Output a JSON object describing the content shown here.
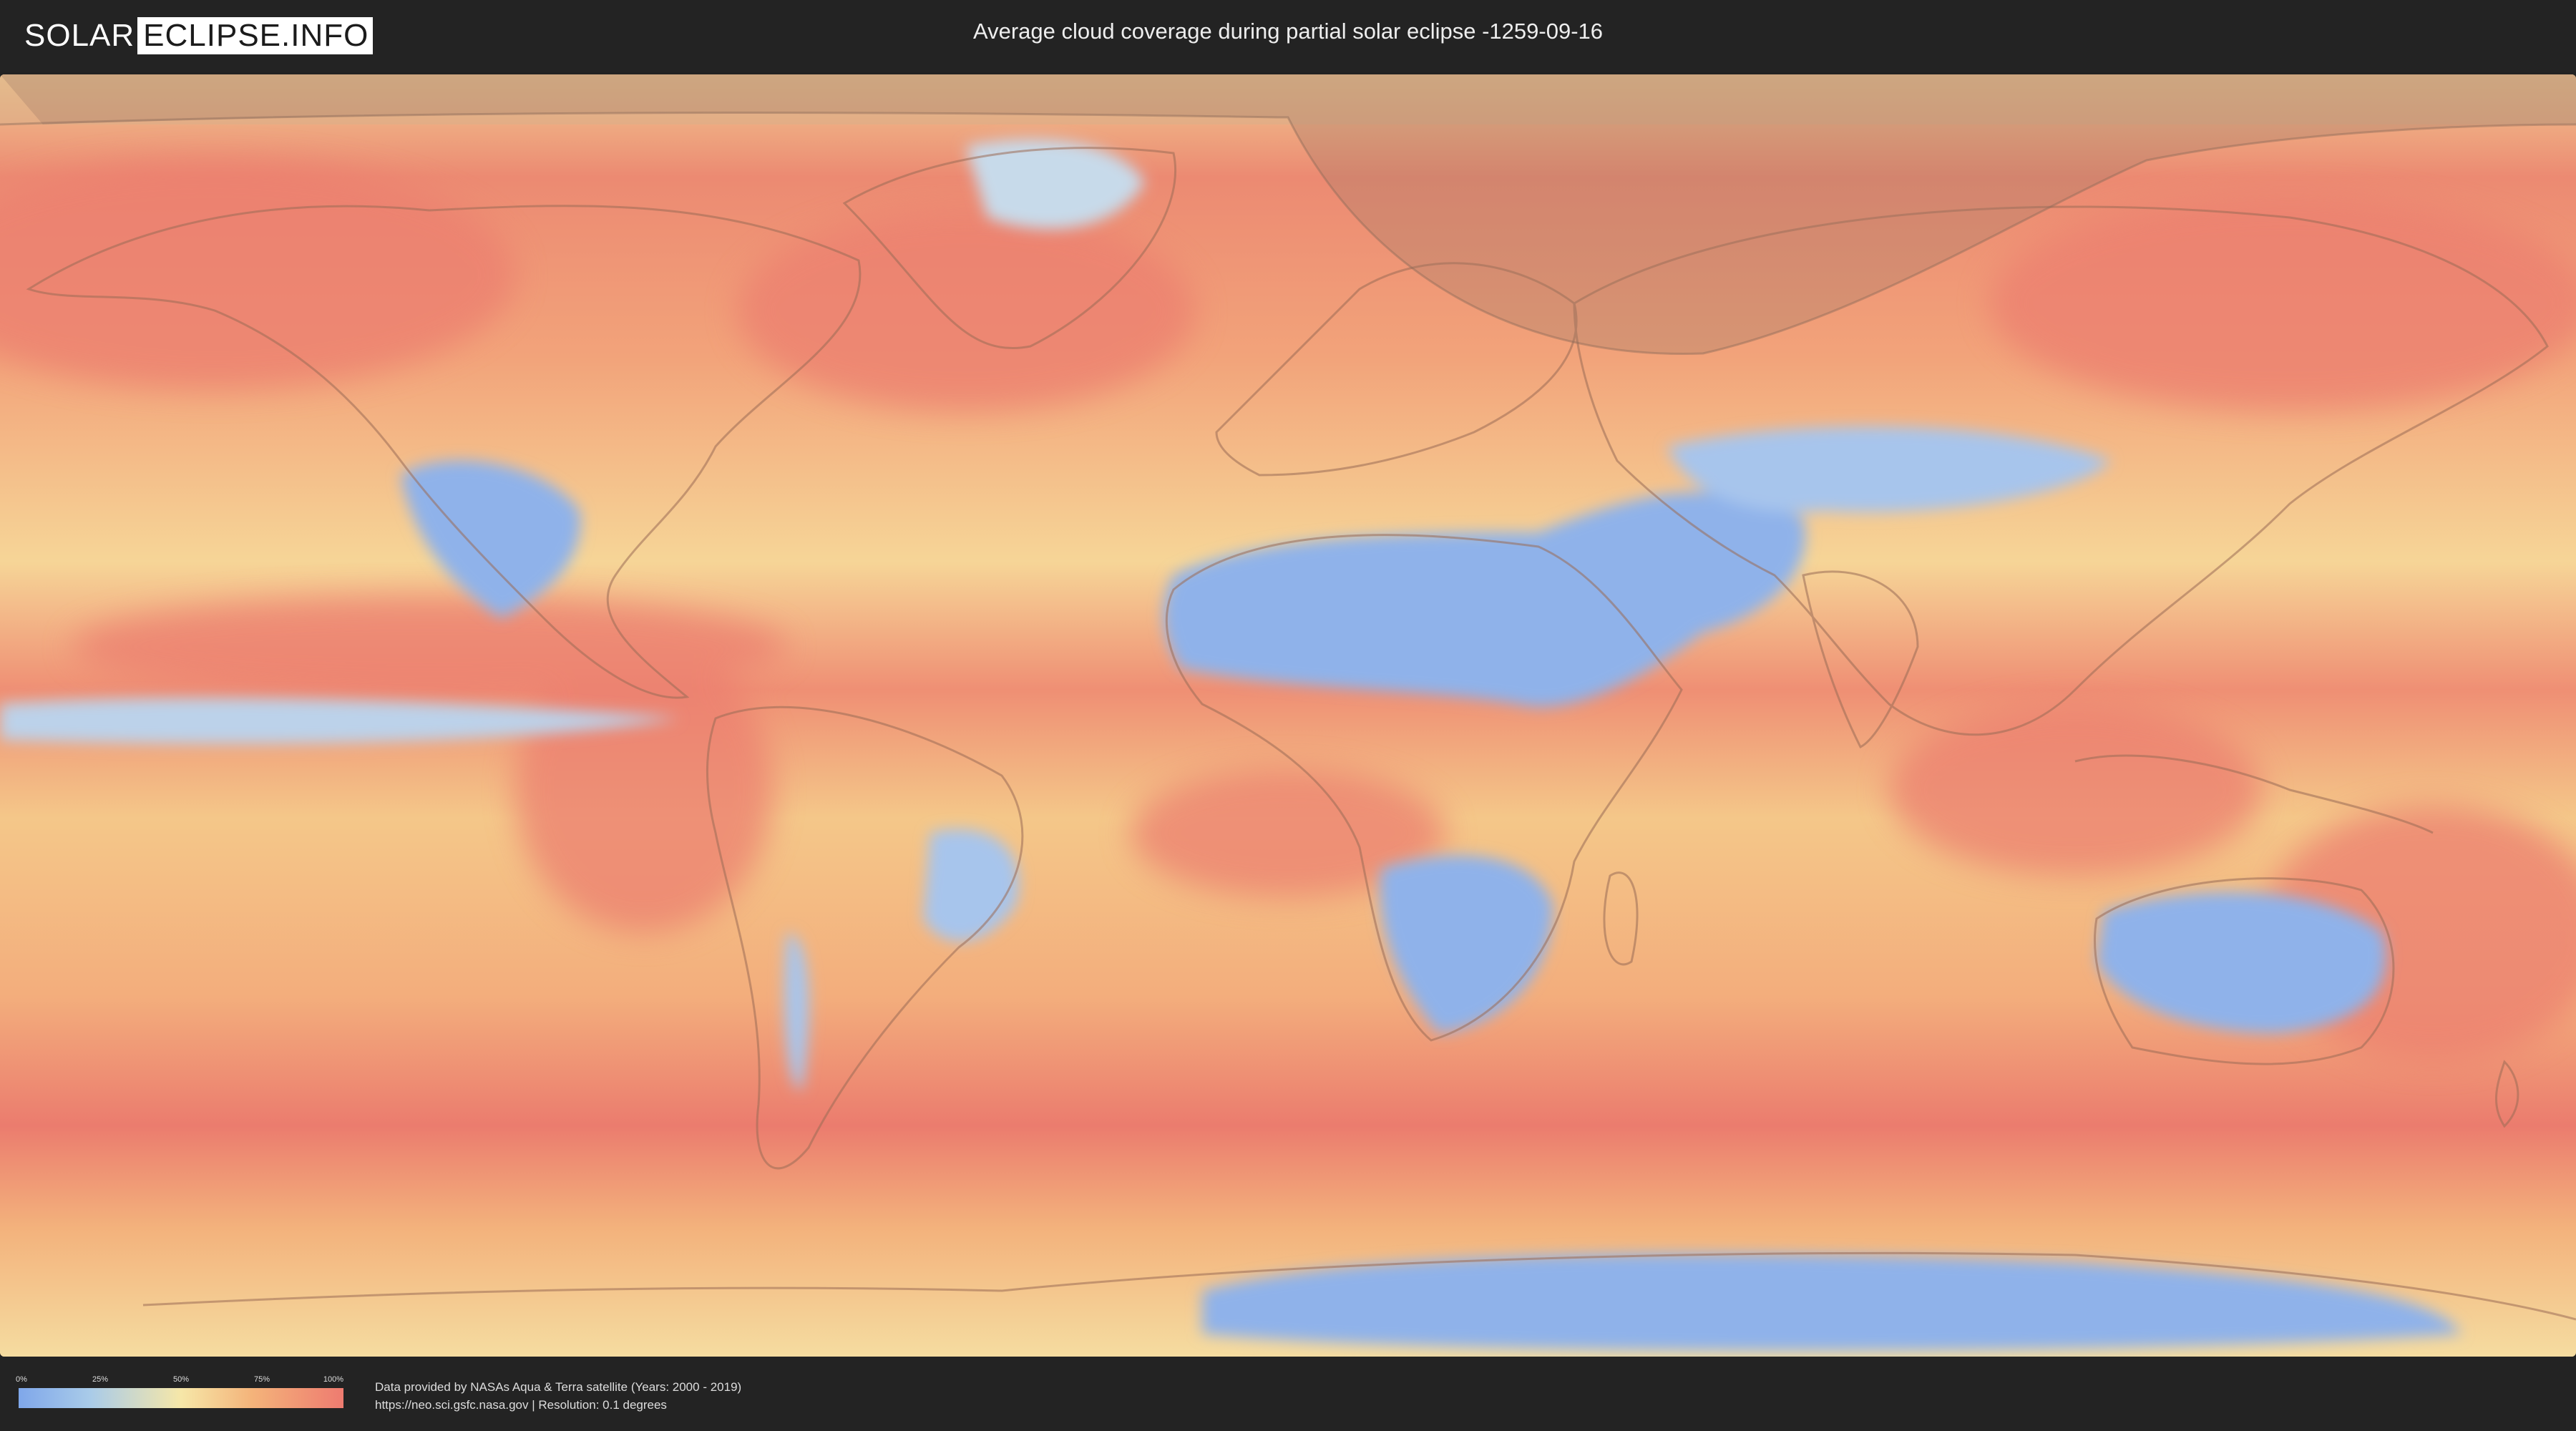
{
  "header": {
    "logo_left": "SOLAR",
    "logo_right": "ECLIPSE.INFO",
    "title": "Average cloud coverage during partial solar eclipse -1259-09-16"
  },
  "map": {
    "description_tag": "cloud-coverage-world-map",
    "colors": {
      "ocean_base": "#f1bf86",
      "high_cloud": "#ec7f6f",
      "mid_cloud": "#f6cf8e",
      "low_cloud": "#8fb2ea",
      "eclipse_shadow": "#a07a66"
    }
  },
  "legend": {
    "ticks": [
      "0%",
      "25%",
      "50%",
      "75%",
      "100%"
    ],
    "colors": [
      "#7fa7ea",
      "#a9cbe9",
      "#f6e7a8",
      "#f4b37a",
      "#ee7b70"
    ]
  },
  "footer": {
    "credit_line1": "Data provided by NASAs Aqua & Terra satellite (Years: 2000 - 2019)",
    "credit_line2": "https://neo.sci.gsfc.nasa.gov | Resolution: 0.1 degrees"
  }
}
